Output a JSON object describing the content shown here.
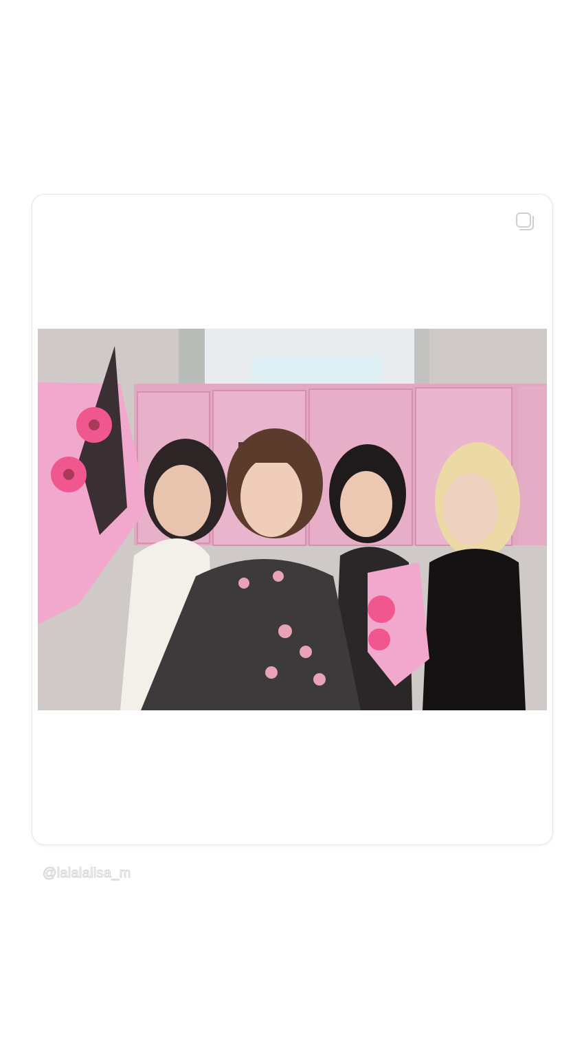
{
  "story": {
    "mention": "@lalalalisa_m"
  },
  "post_card": {
    "icon": "multi-photo-icon",
    "photo": {
      "subject": "group-selfie"
    }
  },
  "colors": {
    "background": "#ffffff",
    "card_border": "#e6e6e6",
    "backdrop_pink": "#e9a9c4",
    "bouquet_pink": "#f2a8cc",
    "flower_pink": "#f0578f"
  }
}
